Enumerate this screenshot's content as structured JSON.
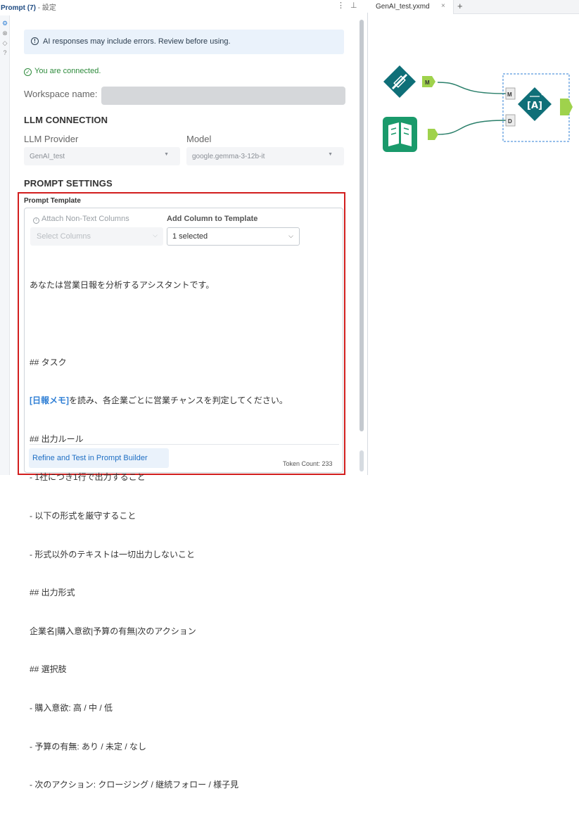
{
  "panel": {
    "title_main": "Prompt (7)",
    "title_sep": " - ",
    "title_sub": "設定",
    "menu_icon": "⋮",
    "pin_icon": "⊥"
  },
  "info_banner": {
    "text": "AI responses may include errors. Review before using."
  },
  "status": {
    "connected_text": "You are connected."
  },
  "workspace": {
    "label": "Workspace name:",
    "value": ""
  },
  "llm_connection": {
    "section_title": "LLM CONNECTION",
    "provider_label": "LLM Provider",
    "provider_value": "GenAI_test",
    "model_label": "Model",
    "model_value": "google.gemma-3-12b-it"
  },
  "prompt_settings": {
    "section_title": "PROMPT SETTINGS",
    "template_label": "Prompt Template",
    "attach_label": "Attach Non-Text Columns",
    "add_column_label": "Add Column to Template",
    "select_columns_placeholder": "Select Columns",
    "add_column_value": "1 selected",
    "prompt_lines": {
      "l1": "あなたは営業日報を分析するアシスタントです。",
      "l2": "",
      "l3": "## タスク",
      "l4_var": "[日報メモ]",
      "l4_rest": "を読み、各企業ごとに営業チャンスを判定してください。",
      "l5": "## 出力ルール",
      "l6": "- 1社につき1行で出力すること",
      "l7": "- 以下の形式を厳守すること",
      "l8": "- 形式以外のテキストは一切出力しないこと",
      "l9": "## 出力形式",
      "l10": "企業名|購入意欲|予算の有無|次のアクション",
      "l11": "## 選択肢",
      "l12": "- 購入意欲: 高 / 中 / 低",
      "l13": "- 予算の有無: あり / 未定 / なし",
      "l14": "- 次のアクション: クロージング / 継続フォロー / 様子見"
    },
    "refine_button": "Refine and Test in Prompt Builder",
    "token_count": "Token Count: 233"
  },
  "tabs": {
    "active_tab": "GenAI_test.yxmd",
    "close_glyph": "×",
    "add_glyph": "+"
  },
  "workflow": {
    "port_m": "M",
    "port_d": "D",
    "colors": {
      "tool_teal": "#0f6f78",
      "tool_green": "#1a9a6b",
      "anchor_green": "#9fd24c",
      "selection_blue": "#2f7fd5",
      "highlight_red": "#d21e1e"
    }
  }
}
